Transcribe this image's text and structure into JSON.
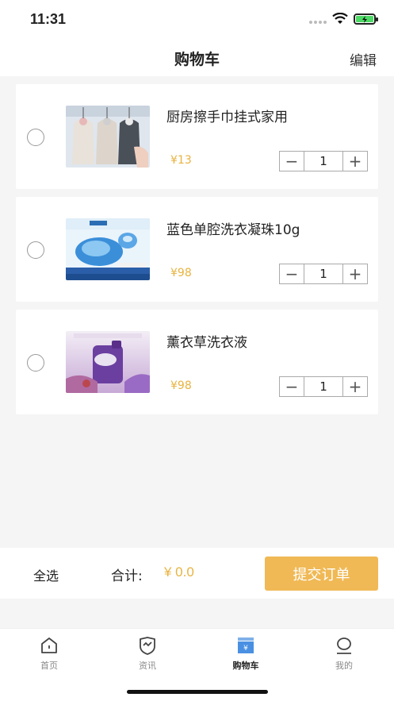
{
  "status_bar": {
    "time": "11:31"
  },
  "nav": {
    "title": "购物车",
    "edit_label": "编辑"
  },
  "cart_items": [
    {
      "name": "厨房擦手巾挂式家用",
      "price": "¥13",
      "quantity": "1",
      "image": "hand-towel-image"
    },
    {
      "name": "蓝色单腔洗衣凝珠10g",
      "price": "¥98",
      "quantity": "1",
      "image": "laundry-pods-image"
    },
    {
      "name": "薰衣草洗衣液",
      "price": "¥98",
      "quantity": "1",
      "image": "lavender-detergent-image"
    }
  ],
  "checkout": {
    "select_all_label": "全选",
    "total_label": "合计:",
    "total_value": "¥ 0.0",
    "submit_label": "提交订单"
  },
  "tabbar": {
    "items": [
      {
        "label": "首页",
        "icon": "home-icon"
      },
      {
        "label": "资讯",
        "icon": "news-icon"
      },
      {
        "label": "购物车",
        "icon": "cart-icon",
        "active": true
      },
      {
        "label": "我的",
        "icon": "profile-icon"
      }
    ]
  },
  "colors": {
    "accent": "#f0b955",
    "price": "#e8b340",
    "tab_active": "#4a90e2"
  }
}
